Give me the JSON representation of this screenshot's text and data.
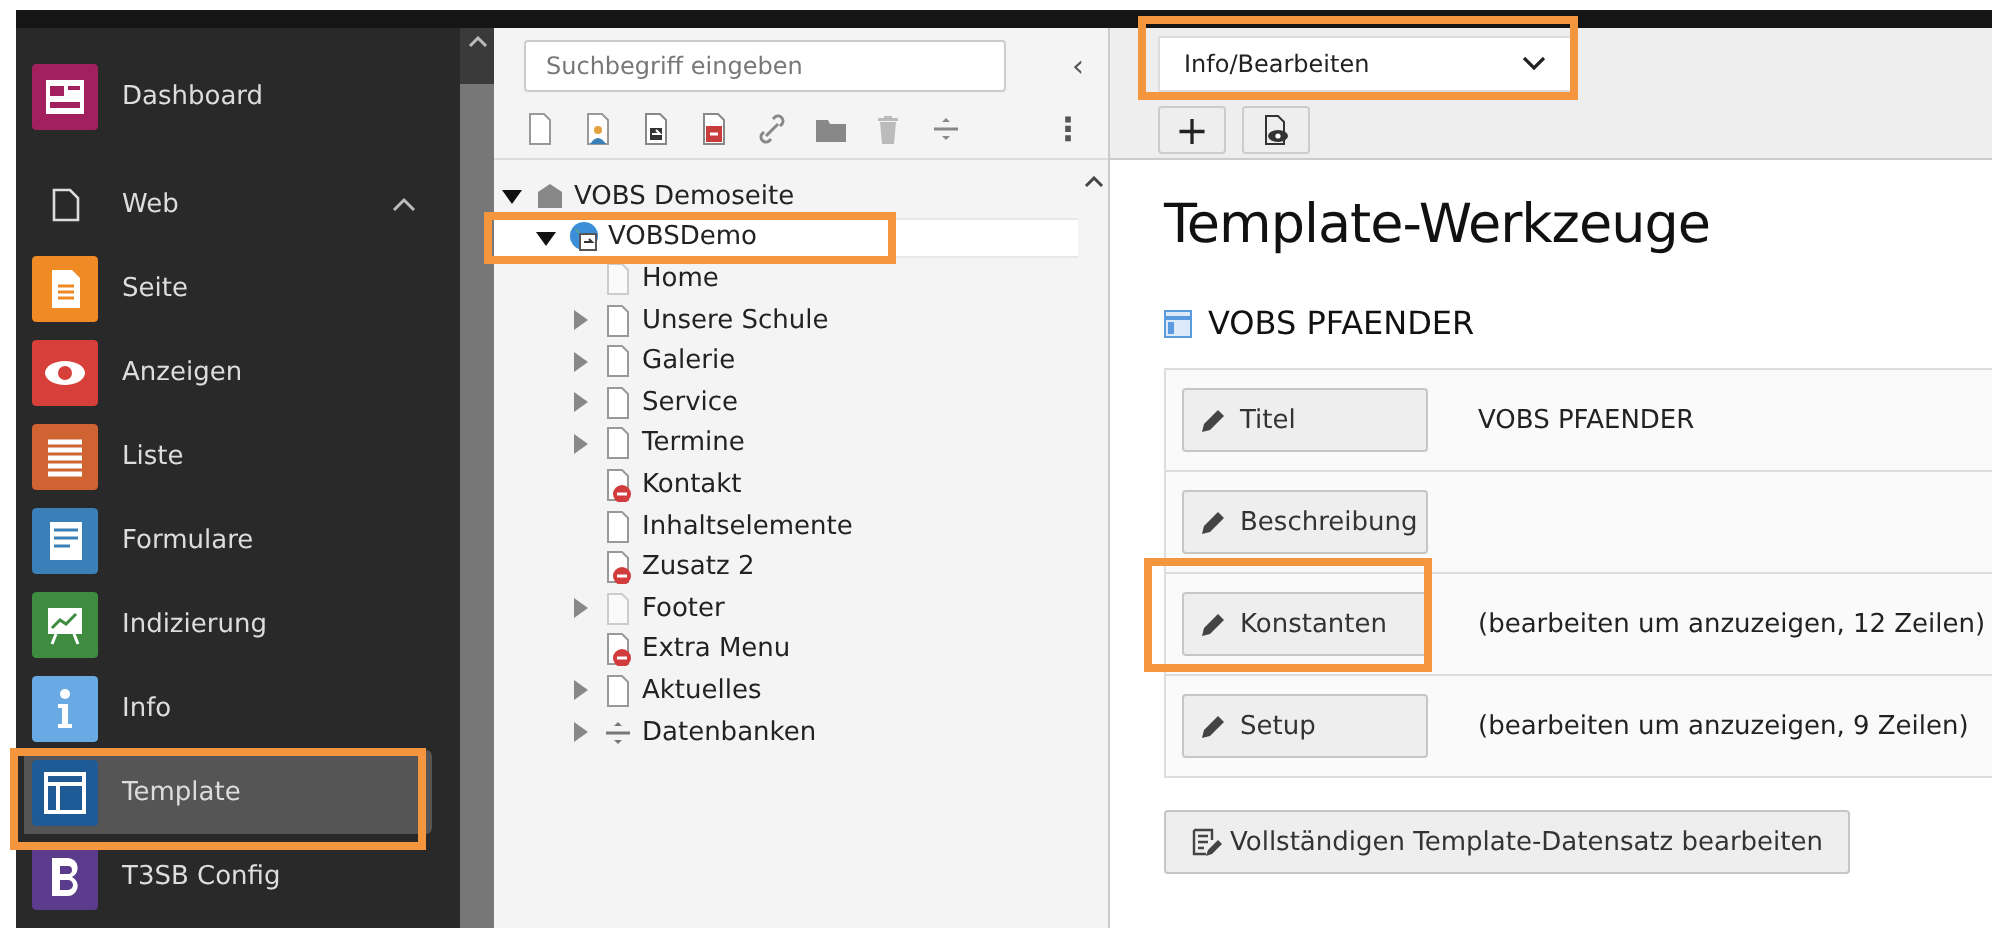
{
  "sidebar": {
    "items": [
      {
        "label": "Dashboard",
        "kind": "module",
        "color": "#a3205f",
        "selected": false,
        "highlighted": false
      },
      {
        "label": "Web",
        "kind": "group",
        "expanded": true,
        "selected": false,
        "highlighted": false
      },
      {
        "label": "Seite",
        "kind": "module",
        "color": "#f08a24",
        "selected": false,
        "highlighted": false
      },
      {
        "label": "Anzeigen",
        "kind": "module",
        "color": "#d7403a",
        "selected": false,
        "highlighted": false
      },
      {
        "label": "Liste",
        "kind": "module",
        "color": "#d06332",
        "selected": false,
        "highlighted": false
      },
      {
        "label": "Formulare",
        "kind": "module",
        "color": "#3a7fb8",
        "selected": false,
        "highlighted": false
      },
      {
        "label": "Indizierung",
        "kind": "module",
        "color": "#3f8b3f",
        "selected": false,
        "highlighted": false
      },
      {
        "label": "Info",
        "kind": "module",
        "color": "#6aaae4",
        "selected": false,
        "highlighted": false
      },
      {
        "label": "Template",
        "kind": "module",
        "color": "#1d5a96",
        "selected": true,
        "highlighted": true
      },
      {
        "label": "T3SB Config",
        "kind": "module",
        "color": "#5b3b8c",
        "selected": false,
        "highlighted": false
      }
    ]
  },
  "page_tree": {
    "search": {
      "placeholder": "Suchbegriff eingeben"
    },
    "collapse_button": "‹",
    "more_button": "⋮",
    "items": [
      {
        "label": "VOBS Demoseite",
        "kind": "site",
        "expandable": true,
        "expanded": true,
        "selected": false,
        "highlighted": false,
        "children": [
          {
            "label": "VOBSDemo",
            "kind": "globe",
            "expandable": true,
            "expanded": true,
            "selected": true,
            "highlighted": true,
            "children": [
              {
                "label": "Home",
                "kind": "faded",
                "expandable": false,
                "selected": false,
                "highlighted": false
              },
              {
                "label": "Unsere Schule",
                "kind": "page",
                "expandable": true,
                "expanded": false,
                "selected": false,
                "highlighted": false
              },
              {
                "label": "Galerie",
                "kind": "page",
                "expandable": true,
                "expanded": false,
                "selected": false,
                "highlighted": false
              },
              {
                "label": "Service",
                "kind": "page",
                "expandable": true,
                "expanded": false,
                "selected": false,
                "highlighted": false
              },
              {
                "label": "Termine",
                "kind": "page",
                "expandable": true,
                "expanded": false,
                "selected": false,
                "highlighted": false
              },
              {
                "label": "Kontakt",
                "kind": "hidden",
                "expandable": false,
                "selected": false,
                "highlighted": false
              },
              {
                "label": "Inhaltselemente",
                "kind": "page",
                "expandable": false,
                "selected": false,
                "highlighted": false
              },
              {
                "label": "Zusatz 2",
                "kind": "hidden",
                "expandable": false,
                "selected": false,
                "highlighted": false
              },
              {
                "label": "Footer",
                "kind": "faded",
                "expandable": true,
                "expanded": false,
                "selected": false,
                "highlighted": false
              },
              {
                "label": "Extra Menu",
                "kind": "hidden",
                "expandable": false,
                "selected": false,
                "highlighted": false
              },
              {
                "label": "Aktuelles",
                "kind": "page",
                "expandable": true,
                "expanded": false,
                "selected": false,
                "highlighted": false
              },
              {
                "label": "Datenbanken",
                "kind": "divider",
                "expandable": true,
                "expanded": false,
                "selected": false,
                "highlighted": false
              }
            ]
          }
        ]
      }
    ]
  },
  "content": {
    "view_select": {
      "value": "Info/Bearbeiten",
      "highlighted": true
    },
    "toolbar_buttons": [
      "+"
    ],
    "heading": "Template-Werkzeuge",
    "template_name": "VOBS PFAENDER",
    "rows": [
      {
        "button": "Titel",
        "value": "VOBS PFAENDER",
        "highlighted": false
      },
      {
        "button": "Beschreibung",
        "highlighted": false
      },
      {
        "button": "Konstanten",
        "value": "(bearbeiten um anzuzeigen, 12 Zeilen)",
        "highlighted": true
      },
      {
        "button": "Setup",
        "value": "(bearbeiten um anzuzeigen, 9 Zeilen)",
        "highlighted": false
      }
    ],
    "full_edit_button": "Vollständigen Template-Datensatz bearbeiten"
  }
}
